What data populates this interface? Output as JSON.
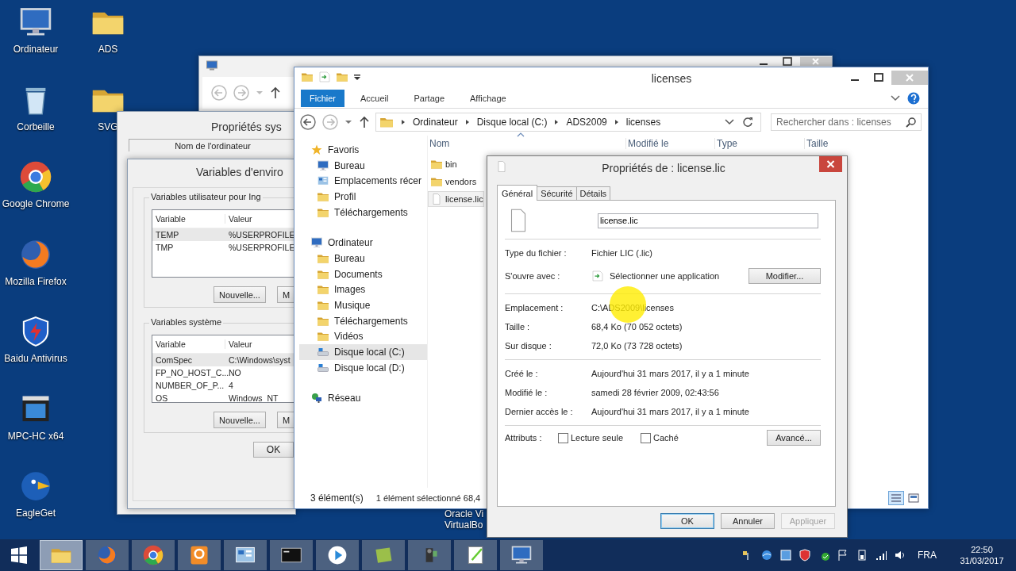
{
  "desktop": {
    "icons": [
      {
        "label": "Ordinateur",
        "kind": "computer"
      },
      {
        "label": "Corbeille",
        "kind": "bin"
      },
      {
        "label": "Google Chrome",
        "kind": "ring"
      },
      {
        "label": "Mozilla Firefox",
        "kind": "globe"
      },
      {
        "label": "Baidu Antivirus",
        "kind": "shield"
      },
      {
        "label": "MPC-HC x64",
        "kind": "film"
      },
      {
        "label": "EagleGet",
        "kind": "bird"
      }
    ],
    "icons_2": [
      {
        "label": "ADS",
        "kind": "folder"
      },
      {
        "label": "SVG",
        "kind": "folder"
      }
    ],
    "cut_label": [
      "Oracle Vi",
      "VirtualBo"
    ]
  },
  "system_properties": {
    "title": "Propriétés sys",
    "tab": "Nom de l'ordinateur"
  },
  "env_dialog": {
    "title": "Variables d'enviro",
    "groups": [
      {
        "title": "Variables utilisateur pour Ing",
        "columns": [
          "Variable",
          "Valeur"
        ],
        "rows": [
          {
            "cells": [
              "TEMP",
              "%USERPROFILE"
            ],
            "selected": true
          },
          {
            "cells": [
              "TMP",
              "%USERPROFILE"
            ],
            "selected": false
          }
        ],
        "buttons": [
          "Nouvelle...",
          "M"
        ]
      },
      {
        "title": "Variables système",
        "columns": [
          "Variable",
          "Valeur"
        ],
        "rows": [
          {
            "cells": [
              "ComSpec",
              "C:\\Windows\\syst"
            ],
            "selected": true
          },
          {
            "cells": [
              "FP_NO_HOST_C...",
              "NO"
            ],
            "selected": false
          },
          {
            "cells": [
              "NUMBER_OF_P...",
              "4"
            ],
            "selected": false
          },
          {
            "cells": [
              "OS",
              "Windows_NT"
            ],
            "selected": false
          }
        ],
        "buttons": [
          "Nouvelle...",
          "M"
        ]
      }
    ],
    "ok": "OK"
  },
  "explorer": {
    "title": "licenses",
    "ribbon_tabs": [
      {
        "label": "Fichier",
        "selected": true
      },
      {
        "label": "Accueil",
        "selected": false
      },
      {
        "label": "Partage",
        "selected": false
      },
      {
        "label": "Affichage",
        "selected": false
      }
    ],
    "breadcrumb": [
      "Ordinateur",
      "Disque local (C:)",
      "ADS2009",
      "licenses"
    ],
    "search": {
      "placeholder": "Rechercher dans : licenses"
    },
    "nav": [
      {
        "label": "Favoris",
        "kind": "star",
        "selected": false,
        "children": [
          {
            "label": "Bureau",
            "kind": "computer",
            "selected": false
          },
          {
            "label": "Emplacements récer",
            "kind": "panel",
            "selected": false
          },
          {
            "label": "Profil",
            "kind": "folder",
            "selected": false
          },
          {
            "label": "Téléchargements",
            "kind": "folder",
            "selected": false
          }
        ]
      },
      {
        "label": "Ordinateur",
        "kind": "computer",
        "selected": false,
        "children": [
          {
            "label": "Bureau",
            "kind": "folder",
            "selected": false
          },
          {
            "label": "Documents",
            "kind": "folder",
            "selected": false
          },
          {
            "label": "Images",
            "kind": "folder",
            "selected": false
          },
          {
            "label": "Musique",
            "kind": "folder",
            "selected": false
          },
          {
            "label": "Téléchargements",
            "kind": "folder",
            "selected": false
          },
          {
            "label": "Vidéos",
            "kind": "folder",
            "selected": false
          },
          {
            "label": "Disque local (C:)",
            "kind": "drive",
            "selected": true
          },
          {
            "label": "Disque local (D:)",
            "kind": "drive",
            "selected": false
          }
        ]
      },
      {
        "label": "Réseau",
        "kind": "network",
        "selected": false
      }
    ],
    "columns": [
      "Nom",
      "Modifié le",
      "Type",
      "Taille"
    ],
    "files": [
      {
        "name": "bin",
        "kind": "folder",
        "selected": false
      },
      {
        "name": "vendors",
        "kind": "folder",
        "selected": false
      },
      {
        "name": "license.lic",
        "kind": "file",
        "selected": true
      }
    ],
    "status": {
      "count": "3 élément(s)",
      "selection": "1 élément sélectionné 68,4"
    }
  },
  "properties": {
    "title": "Propriétés de : license.lic",
    "tabs": [
      {
        "label": "Général",
        "selected": true
      },
      {
        "label": "Sécurité",
        "selected": false
      },
      {
        "label": "Détails",
        "selected": false
      }
    ],
    "file_name": "license.lic",
    "sections": [
      [
        {
          "kind": "text",
          "label": "Type du fichier :",
          "value": "Fichier LIC (.lic)"
        },
        {
          "kind": "app",
          "label": "S'ouvre avec :",
          "value": "Sélectionner une application",
          "button": "Modifier..."
        }
      ],
      [
        {
          "kind": "text",
          "label": "Emplacement :",
          "value": "C:\\ADS2009\\licenses"
        },
        {
          "kind": "text",
          "label": "Taille :",
          "value": "68,4 Ko (70 052 octets)"
        },
        {
          "kind": "text",
          "label": "Sur disque :",
          "value": "72,0 Ko (73 728 octets)"
        }
      ],
      [
        {
          "kind": "text",
          "label": "Créé le :",
          "value": "Aujourd'hui 31 mars 2017, il y a 1 minute"
        },
        {
          "kind": "text",
          "label": "Modifié le :",
          "value": "samedi 28 février 2009, 02:43:56"
        },
        {
          "kind": "text",
          "label": "Dernier accès le :",
          "value": "Aujourd'hui 31 mars 2017, il y a 1 minute"
        }
      ]
    ],
    "attributes": {
      "label": "Attributs :",
      "options": [
        {
          "label": "Lecture seule",
          "checked": false
        },
        {
          "label": "Caché",
          "checked": false
        }
      ],
      "button": "Avancé..."
    },
    "buttons": [
      {
        "label": "OK",
        "default": true,
        "disabled": false
      },
      {
        "label": "Annuler",
        "default": false,
        "disabled": false
      },
      {
        "label": "Appliquer",
        "default": false,
        "disabled": true
      }
    ]
  },
  "taskbar": {
    "apps": [
      {
        "kind": "folder",
        "active": true
      },
      {
        "kind": "globe",
        "active": false
      },
      {
        "kind": "ring",
        "active": false
      },
      {
        "kind": "pdf",
        "active": false
      },
      {
        "kind": "panel",
        "active": false
      },
      {
        "kind": "terminal",
        "active": false
      },
      {
        "kind": "play",
        "active": false
      },
      {
        "kind": "tile",
        "active": false
      },
      {
        "kind": "camera",
        "active": false
      },
      {
        "kind": "notepad",
        "active": false
      },
      {
        "kind": "computer",
        "active": false
      }
    ],
    "language": "FRA",
    "time": "22:50",
    "date": "31/03/2017"
  }
}
